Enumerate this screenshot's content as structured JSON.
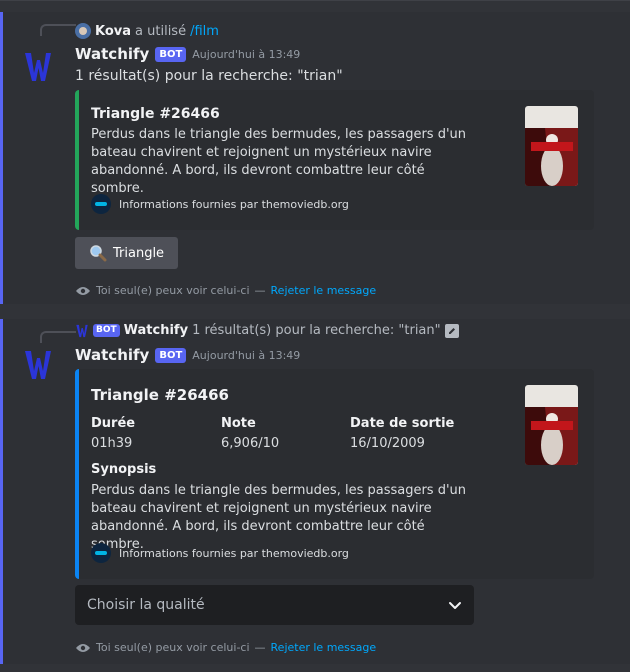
{
  "colors": {
    "accent": "#5865f2",
    "embed1_edge": "#23a55a",
    "embed2_edge": "#0b84f3",
    "link": "#00a8fc"
  },
  "message1": {
    "reply": {
      "user": "Kova",
      "action": "a utilisé",
      "command": "/film"
    },
    "username": "Watchify",
    "badge": "BOT",
    "timestamp": "Aujourd'hui à 13:49",
    "text": "1 résultat(s) pour la recherche: \"trian\"",
    "embed": {
      "title": "Triangle #26466",
      "description": "Perdus dans le triangle des bermudes, les passagers d'un bateau chavirent et rejoignent un mystérieux navire abandonné. A bord, ils devront combattre leur côté sombre.",
      "footer": "Informations fournies par themoviedb.org",
      "thumbnail": "movie-poster"
    },
    "button": {
      "icon": "magnifier-icon",
      "label": "Triangle"
    },
    "ephemeral": {
      "text": "Toi seul(e) peux voir celui-ci",
      "separator": "—",
      "dismiss": "Rejeter le message"
    }
  },
  "message2": {
    "reply": {
      "badge": "BOT",
      "user": "Watchify",
      "text": "1 résultat(s) pour la recherche: \"trian\""
    },
    "username": "Watchify",
    "badge": "BOT",
    "timestamp": "Aujourd'hui à 13:49",
    "embed": {
      "title": "Triangle #26466",
      "fields": [
        {
          "name": "Durée",
          "value": "01h39"
        },
        {
          "name": "Note",
          "value": "6,906/10"
        },
        {
          "name": "Date de sortie",
          "value": "16/10/2009"
        }
      ],
      "synopsis_label": "Synopsis",
      "description": "Perdus dans le triangle des bermudes, les passagers d'un bateau chavirent et rejoignent un mystérieux navire abandonné. A bord, ils devront combattre leur côté sombre.",
      "footer": "Informations fournies par themoviedb.org",
      "thumbnail": "movie-poster"
    },
    "select": {
      "placeholder": "Choisir la qualité"
    },
    "ephemeral": {
      "text": "Toi seul(e) peux voir celui-ci",
      "separator": "—",
      "dismiss": "Rejeter le message"
    }
  }
}
